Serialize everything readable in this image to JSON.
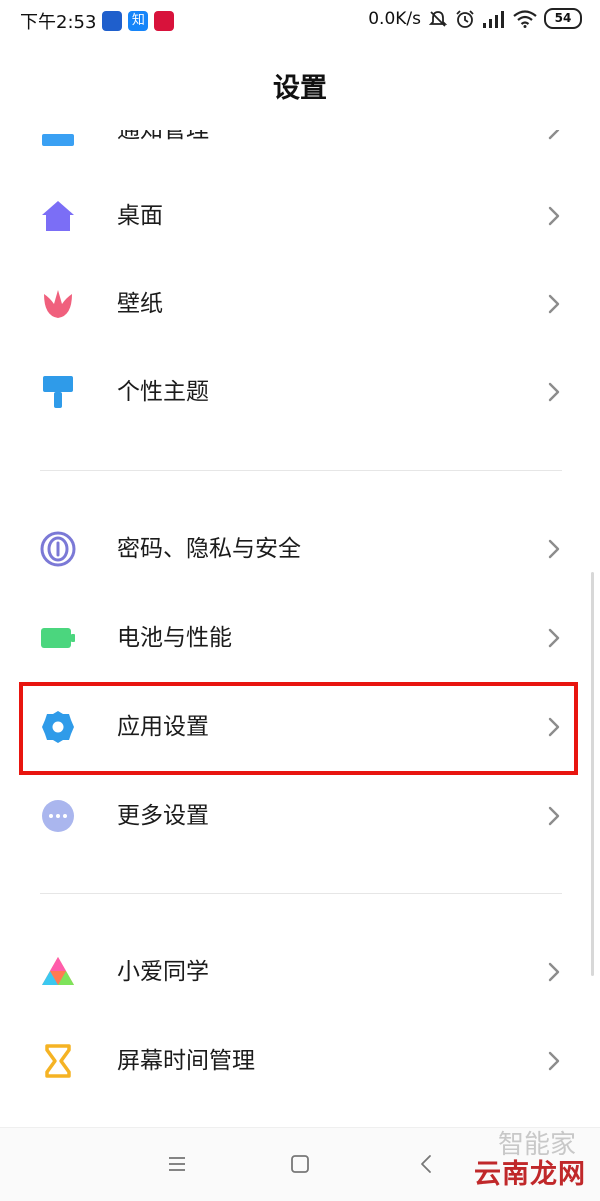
{
  "status_bar": {
    "time": "下午2:53",
    "network_speed": "0.0K/s",
    "battery_level": "54",
    "icons": [
      "news-app-icon",
      "zhihu-app-icon",
      "tmall-app-icon",
      "mute-icon",
      "alarm-icon",
      "signal-icon",
      "wifi-icon",
      "battery-icon"
    ]
  },
  "header": {
    "title": "设置"
  },
  "settings": {
    "partial_top": {
      "label": "通知管理",
      "icon": "notification-icon",
      "color": "#3aa0f3"
    },
    "group1": [
      {
        "label": "桌面",
        "icon": "home-icon",
        "color": "#7b6ef6"
      },
      {
        "label": "壁纸",
        "icon": "tulip-icon",
        "color": "#f0607d"
      },
      {
        "label": "个性主题",
        "icon": "paintbrush-icon",
        "color": "#2f9be9"
      }
    ],
    "group2": [
      {
        "label": "密码、隐私与安全",
        "icon": "fingerprint-icon",
        "color": "#7b79d6"
      },
      {
        "label": "电池与性能",
        "icon": "battery-icon",
        "color": "#4bd67e"
      },
      {
        "label": "应用设置",
        "icon": "gear-icon",
        "color": "#2f9be9",
        "highlighted": true
      },
      {
        "label": "更多设置",
        "icon": "more-icon",
        "color": "#aab6ee"
      }
    ],
    "group3": [
      {
        "label": "小爱同学",
        "icon": "xiaoai-icon",
        "color": "#ff7a52"
      },
      {
        "label": "屏幕时间管理",
        "icon": "hourglass-icon",
        "color": "#f5b324"
      }
    ]
  },
  "highlight_color": "#e8150f",
  "watermark": {
    "text": "云南龙网",
    "faint_text": "智能家"
  },
  "navigation": [
    "menu-icon",
    "home-square-icon",
    "back-icon"
  ]
}
